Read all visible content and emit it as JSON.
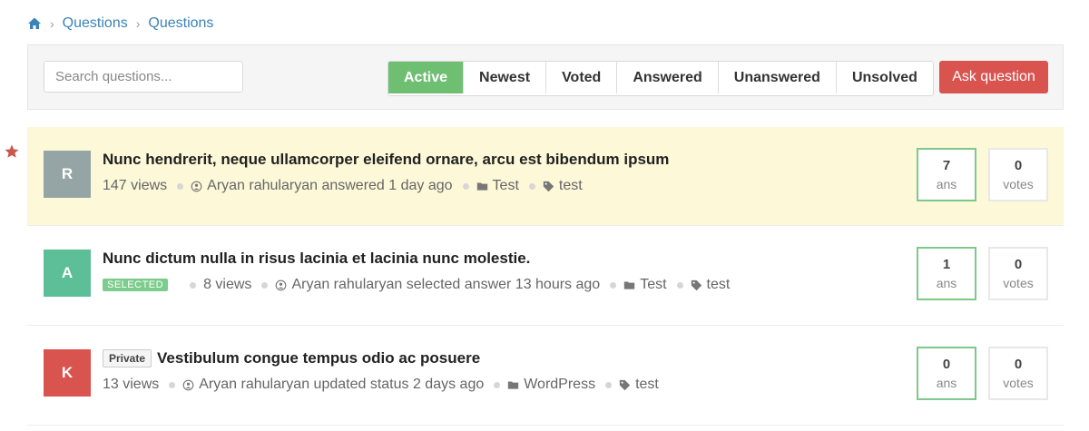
{
  "breadcrumb": {
    "items": [
      "Questions",
      "Questions"
    ]
  },
  "toolbar": {
    "search_placeholder": "Search questions...",
    "filters": [
      "Active",
      "Newest",
      "Voted",
      "Answered",
      "Unanswered",
      "Unsolved"
    ],
    "active_filter": "Active",
    "ask_label": "Ask question"
  },
  "colors": {
    "link": "#3b82b8",
    "active_tab": "#6fbf73",
    "ask_button": "#d9534f",
    "featured_bg": "#fcf8d8",
    "answer_border": "#7ec88a"
  },
  "questions": [
    {
      "avatar_letter": "R",
      "avatar_color": "#95a5a6",
      "featured": true,
      "title": "Nunc hendrerit, neque ullamcorper eleifend ornare, arcu est bibendum ipsum",
      "views": "147 views",
      "activity": "Aryan rahularyan answered 1 day ago",
      "category": "Test",
      "tag": "test",
      "answers": "7",
      "answers_label": "ans",
      "votes": "0",
      "votes_label": "votes"
    },
    {
      "avatar_letter": "A",
      "avatar_color": "#5cbf98",
      "selected_badge": "SELECTED",
      "title": "Nunc dictum nulla in risus lacinia et lacinia nunc molestie.",
      "views": "8 views",
      "activity": "Aryan rahularyan selected answer 13 hours ago",
      "category": "Test",
      "tag": "test",
      "answers": "1",
      "answers_label": "ans",
      "votes": "0",
      "votes_label": "votes"
    },
    {
      "avatar_letter": "K",
      "avatar_color": "#d9534f",
      "private_badge": "Private",
      "title": "Vestibulum congue tempus odio ac posuere",
      "views": "13 views",
      "activity": "Aryan rahularyan updated status 2 days ago",
      "category": "WordPress",
      "tag": "test",
      "answers": "0",
      "answers_label": "ans",
      "votes": "0",
      "votes_label": "votes"
    }
  ],
  "icons": {
    "home": "home-icon",
    "star": "star-icon",
    "user": "user-icon",
    "folder": "folder-icon",
    "tag": "tag-icon"
  }
}
